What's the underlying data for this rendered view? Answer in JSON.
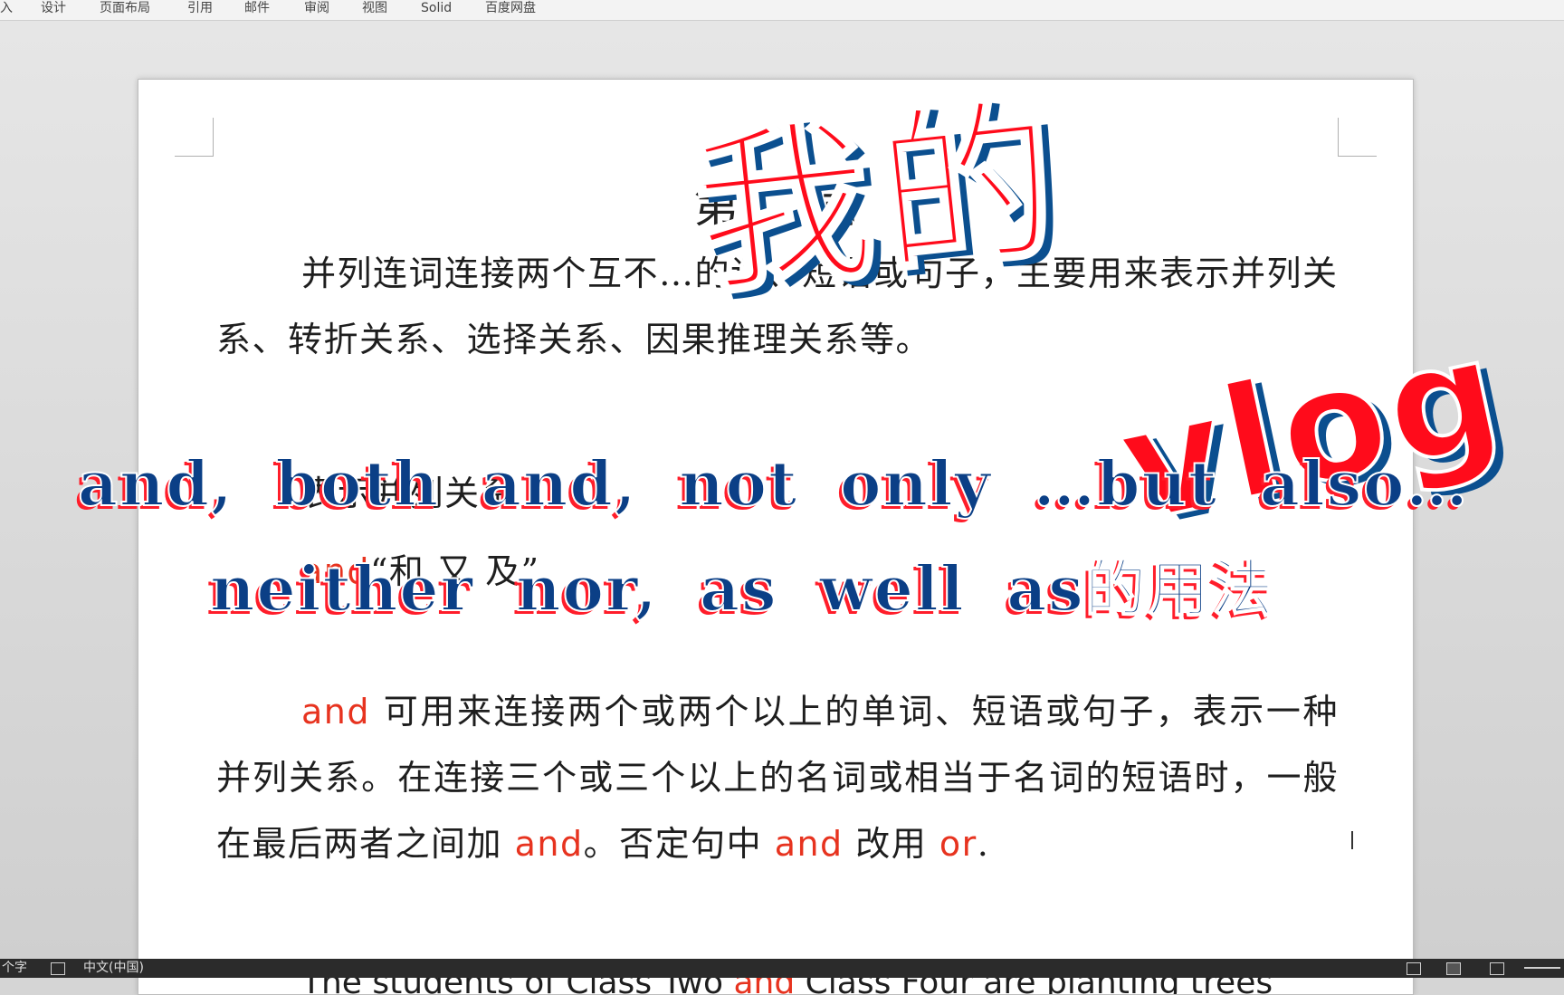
{
  "ribbon": {
    "tabs": [
      "入",
      "设计",
      "页面布局",
      "引用",
      "邮件",
      "审阅",
      "视图",
      "Solid",
      "百度网盘"
    ]
  },
  "document": {
    "title": "第6…同",
    "p1": "并列连词连接两个互不…的词、短语或句子，主要用来表示并列关系、转折关系、选择关系、因果推理关系等。",
    "h2": "表示并列关系",
    "h3_red": "and",
    "h3_rest": "“和 又 及”",
    "p2_and": "and",
    "p2_a": " 可用来连接两个或两个以上的单词、短语或句子，表示一种并列关系。在连接三个或三个以上的名词或相当于名词的短语时，一般在最后两者之间加 ",
    "p2_and2": "and",
    "p2_b": "。否定句中 ",
    "p2_and3": "and",
    "p2_c": " 改用 ",
    "p2_or": "or",
    "p2_d": ".",
    "p3_a": "The students of Class Two ",
    "p3_and": "and",
    "p3_b": " Class Four are planting trees"
  },
  "overlay": {
    "wode": "我的",
    "vlog": "vlog",
    "sub1": "and, both and, not only …but also…",
    "sub2": "neither nor, as well as的用法"
  },
  "statusbar": {
    "words": "个字",
    "lang": "中文(中国)"
  },
  "colors": {
    "red_keyword": "#e7331f",
    "overlay_red": "#ff0b1b",
    "overlay_blue": "#0b4f8f"
  }
}
